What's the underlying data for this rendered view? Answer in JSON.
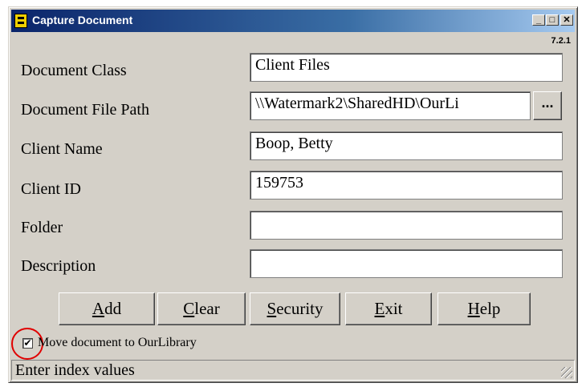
{
  "window": {
    "title": "Capture Document",
    "version": "7.2.1",
    "controls": {
      "minimize": "_",
      "maximize": "□",
      "close": "✕"
    }
  },
  "form": {
    "document_class": {
      "label": "Document Class",
      "value": "Client Files"
    },
    "document_file_path": {
      "label": "Document File Path",
      "value": "\\\\Watermark2\\SharedHD\\OurLi",
      "browse_label": "..."
    },
    "client_name": {
      "label": "Client Name",
      "value": "Boop, Betty"
    },
    "client_id": {
      "label": "Client ID",
      "value": "159753"
    },
    "folder": {
      "label": "Folder",
      "value": ""
    },
    "description": {
      "label": "Description",
      "value": ""
    }
  },
  "buttons": {
    "add": {
      "mnemonic": "A",
      "rest": "dd"
    },
    "clear": {
      "mnemonic": "C",
      "rest": "lear"
    },
    "security": {
      "mnemonic": "S",
      "rest": "ecurity"
    },
    "exit": {
      "mnemonic": "E",
      "rest": "xit"
    },
    "help": {
      "mnemonic": "H",
      "rest": "elp"
    }
  },
  "move_checkbox": {
    "checked_mark": "✔",
    "label": "Move document to OurLibrary",
    "checked": true
  },
  "status_bar": {
    "text": "Enter index values"
  },
  "annotation": {
    "highlight_color": "#e00000"
  }
}
